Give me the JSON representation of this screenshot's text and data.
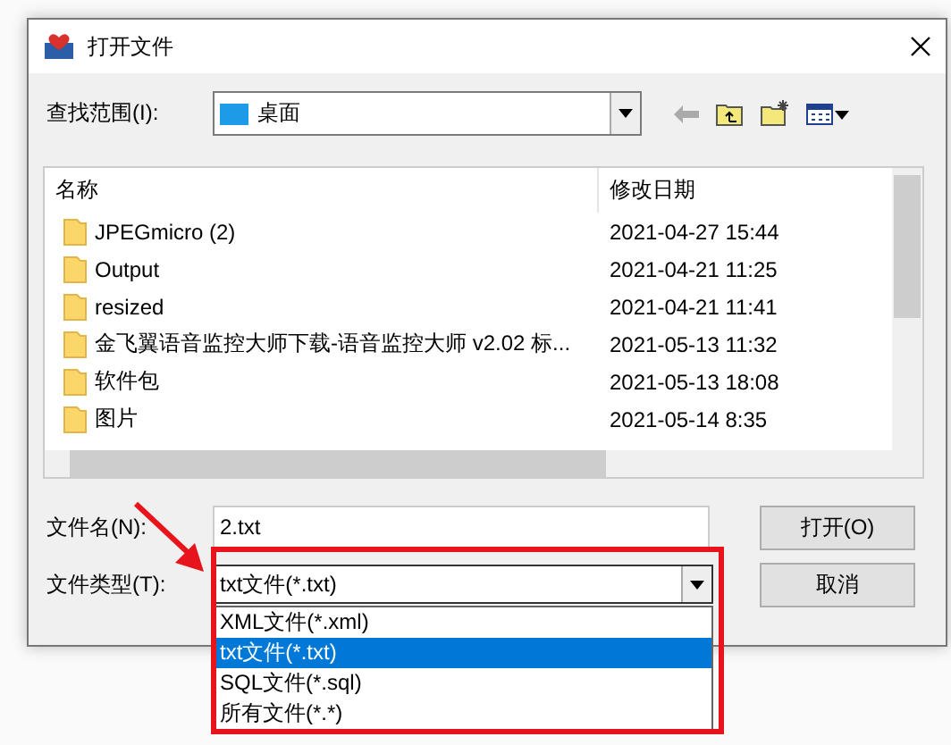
{
  "window": {
    "title": "打开文件"
  },
  "look_in": {
    "label": "查找范围(I):",
    "value": "桌面"
  },
  "file_list": {
    "columns": [
      "名称",
      "修改日期"
    ],
    "rows": [
      {
        "name": "JPEGmicro (2)",
        "date": "2021-04-27 15:44"
      },
      {
        "name": "Output",
        "date": "2021-04-21 11:25"
      },
      {
        "name": "resized",
        "date": "2021-04-21 11:41"
      },
      {
        "name": "金飞翼语音监控大师下载-语音监控大师 v2.02 标...",
        "date": "2021-05-13 11:32"
      },
      {
        "name": "软件包",
        "date": "2021-05-13 18:08"
      },
      {
        "name": "图片",
        "date": "2021-05-14 8:35"
      }
    ]
  },
  "file_name": {
    "label": "文件名(N):",
    "value": "2.txt"
  },
  "file_type": {
    "label": "文件类型(T):",
    "value": "txt文件(*.txt)",
    "expanded": true,
    "options": [
      {
        "label": "XML文件(*.xml)",
        "selected": false
      },
      {
        "label": "txt文件(*.txt)",
        "selected": true
      },
      {
        "label": "SQL文件(*.sql)",
        "selected": false
      },
      {
        "label": "所有文件(*.*)",
        "selected": false
      }
    ]
  },
  "buttons": [
    {
      "label": "打开(O)"
    },
    {
      "label": "取消"
    }
  ]
}
